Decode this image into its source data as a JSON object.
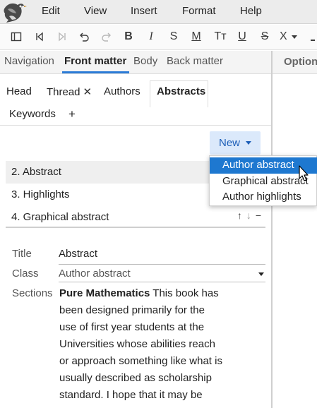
{
  "menu": {
    "items": [
      "Edit",
      "View",
      "Insert",
      "Format",
      "Help"
    ]
  },
  "toolbar": {
    "icons": [
      "sidebar-toggle-icon",
      "first-icon",
      "last-icon",
      "undo-icon",
      "redo-icon",
      "bold-icon",
      "italic-icon",
      "strikethrough-icon",
      "monospace-icon",
      "text-size-icon",
      "underline-icon",
      "strike-alt-icon",
      "clear-format-icon"
    ],
    "bold": "B",
    "italic": "I",
    "s": "S",
    "m": "M",
    "tt": "Tт",
    "u": "U",
    "strike": "S",
    "x": "X"
  },
  "top_tabs": {
    "navigation": "Navigation",
    "front_matter": "Front matter",
    "body": "Body",
    "back_matter": "Back matter",
    "options": "Option"
  },
  "sub_tabs": {
    "head": "Head",
    "thread": "Thread",
    "authors": "Authors",
    "abstracts": "Abstracts",
    "keywords": "Keywords",
    "add": "+"
  },
  "new_button": {
    "label": "New"
  },
  "list": {
    "rows": [
      {
        "label": "2. Abstract"
      },
      {
        "label": "3. Highlights"
      },
      {
        "label": "4. Graphical abstract"
      }
    ]
  },
  "dropdown": {
    "items": [
      "Author abstract",
      "Graphical abstract",
      "Author highlights"
    ],
    "selected_index": 0
  },
  "form": {
    "title_label": "Title",
    "title_value": "Abstract",
    "class_label": "Class",
    "class_value": "Author abstract",
    "sections_label": "Sections",
    "sections_bold": "Pure Mathematics",
    "sections_text": " This book has been designed primarily for the use of first year students at the Universities whose abilities reach or approach something like what is usually described as scholarship standard. I hope that it may be"
  },
  "colors": {
    "accent": "#2b7bd6",
    "selected": "#1e78d0",
    "new_button_bg": "#dbe9fb"
  }
}
